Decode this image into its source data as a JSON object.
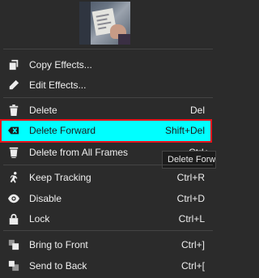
{
  "thumbnail": {
    "icon": "video-frame-thumbnail"
  },
  "menu": {
    "copy_effects": {
      "label": "Copy Effects...",
      "icon": "copy-icon"
    },
    "edit_effects": {
      "label": "Edit Effects...",
      "icon": "pencil-icon"
    },
    "delete": {
      "label": "Delete",
      "shortcut": "Del",
      "icon": "trash-icon"
    },
    "delete_forward": {
      "label": "Delete Forward",
      "shortcut": "Shift+Del",
      "icon": "delete-forward-icon"
    },
    "delete_all_frames": {
      "label": "Delete from All Frames",
      "shortcut": "Ctrl+",
      "icon": "trash-frames-icon"
    },
    "keep_tracking": {
      "label": "Keep Tracking",
      "shortcut": "Ctrl+R",
      "icon": "running-person-icon"
    },
    "disable": {
      "label": "Disable",
      "shortcut": "Ctrl+D",
      "icon": "eye-icon"
    },
    "lock": {
      "label": "Lock",
      "shortcut": "Ctrl+L",
      "icon": "lock-icon"
    },
    "bring_to_front": {
      "label": "Bring to Front",
      "shortcut": "Ctrl+]",
      "icon": "bring-front-icon"
    },
    "send_to_back": {
      "label": "Send to Back",
      "shortcut": "Ctrl+[",
      "icon": "send-back-icon"
    }
  },
  "tooltip": {
    "text": "Delete Forw"
  },
  "colors": {
    "menu_bg": "#2b2b2b",
    "highlight": "#00ffff",
    "highlight_border": "#e8141c",
    "text": "#f0f0f0"
  }
}
